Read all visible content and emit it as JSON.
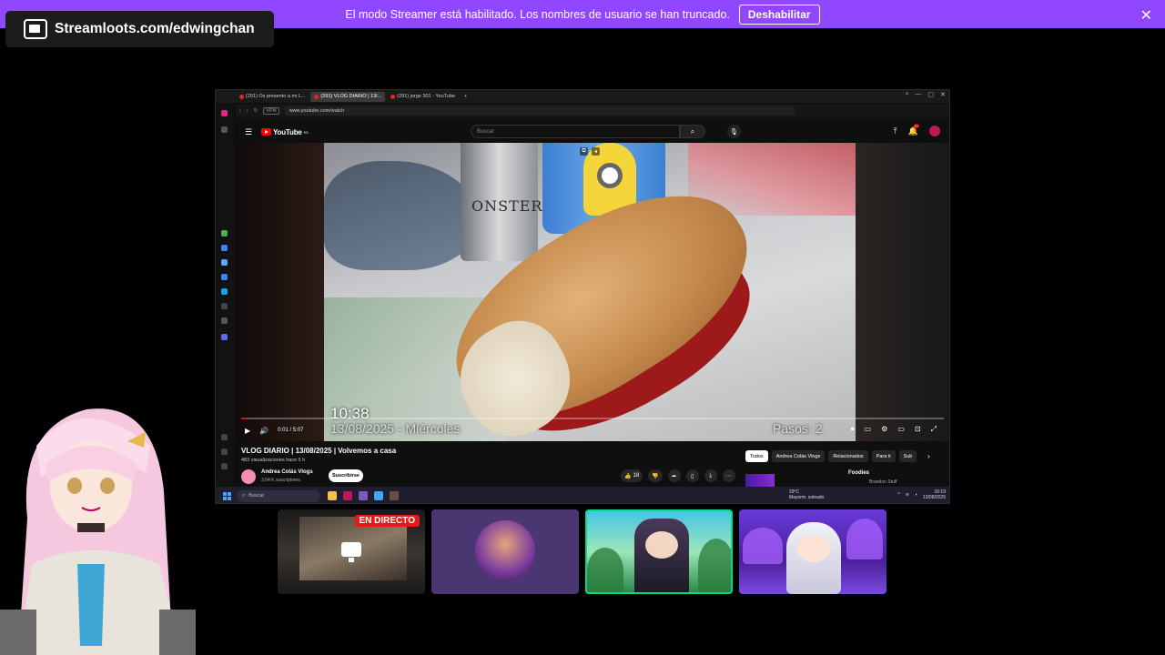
{
  "banner": {
    "message": "El modo Streamer está habilitado. Los nombres de usuario se han truncado.",
    "button": "Deshabilitar",
    "close": "✕"
  },
  "streamloots": {
    "text": "Streamloots.com/edwingchan"
  },
  "browser": {
    "tabs": [
      {
        "label": "(291) Os presento a mi L..."
      },
      {
        "label": "(291) VLOG DIARIO | 13/..."
      },
      {
        "label": "(291) jorge 301 - YouTube"
      }
    ],
    "new_tab": "+",
    "url": "www.youtube.com/watch",
    "vpn": "VPN",
    "window_controls": [
      "⌕",
      "—",
      "▢",
      "✕"
    ]
  },
  "youtube": {
    "logo": "YouTube",
    "logo_sup": "ES",
    "search_placeholder": "Buscar",
    "notif_count": "9+"
  },
  "video": {
    "overlay_time": "10:38",
    "overlay_date": "13/08/2025 - Miércoles",
    "overlay_steps": "Pasos: 2",
    "time": "0:01 / 5:07",
    "progress_fraction": 0.003,
    "can_text": "ONSTER",
    "title": "VLOG DIARIO | 13/08/2025 | Volvemos a casa",
    "meta": "483 visualizaciones  hace 5 h",
    "channel": "Andrea Colás Vlogs",
    "subs": "3,64 K suscriptores",
    "subscribe": "Suscribirse",
    "likes": "18"
  },
  "chips": [
    "Todos",
    "Andrea Colás Vlogs",
    "Relacionados",
    "Para ti",
    "Sub"
  ],
  "sidebar_rec": {
    "title": "Foodies",
    "sub": "Brandon Stuff"
  },
  "taskbar": {
    "search": "Buscar",
    "weather_temp": "29°C",
    "weather_desc": "Mayorm. soleado",
    "time": "16:19",
    "date": "13/08/2025"
  },
  "cards": {
    "live_badge": "EN DIRECTO"
  },
  "colors": {
    "streamer_banner": "#9146ff",
    "youtube_red": "#ff0000",
    "live_red": "#e91916",
    "selected_card": "#00db84"
  }
}
